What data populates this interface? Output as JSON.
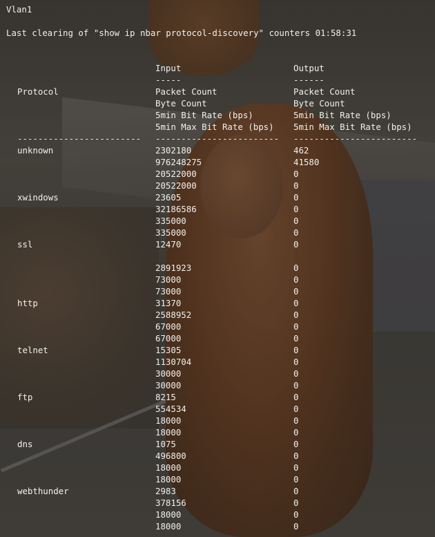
{
  "header": {
    "interface": "Vlan1",
    "last_clearing": "Last clearing of \"show ip nbar protocol-discovery\" counters 01:58:31"
  },
  "columns": {
    "input_title": "Input",
    "output_title": "Output",
    "underline": "-----",
    "output_underline": "------",
    "protocol": "Protocol",
    "metrics": [
      "Packet Count",
      "Byte Count",
      "5min Bit Rate (bps)",
      "5min Max Bit Rate (bps)"
    ],
    "dashes_protocol": "------------------------",
    "dashes_input": "------------------------",
    "dashes_output": "------------------------"
  },
  "rows": [
    {
      "protocol": "unknown",
      "input": [
        "2302180",
        "976248275",
        "20522000",
        "20522000"
      ],
      "output": [
        "462",
        "41580",
        "0",
        "0"
      ]
    },
    {
      "protocol": "xwindows",
      "input": [
        "23605",
        "32186586",
        "335000",
        "335000"
      ],
      "output": [
        "0",
        "0",
        "0",
        "0"
      ]
    },
    {
      "protocol": "ssl",
      "input": [
        "12470",
        "",
        "2891923",
        "73000",
        "73000"
      ],
      "output": [
        "0",
        "",
        "0",
        "0",
        "0"
      ]
    },
    {
      "protocol": "http",
      "input": [
        "31370",
        "2588952",
        "67000",
        "67000"
      ],
      "output": [
        "0",
        "0",
        "0",
        "0"
      ]
    },
    {
      "protocol": "telnet",
      "input": [
        "15305",
        "1130704",
        "30000",
        "30000"
      ],
      "output": [
        "0",
        "0",
        "0",
        "0"
      ]
    },
    {
      "protocol": "ftp",
      "input": [
        "8215",
        "554534",
        "18000",
        "18000"
      ],
      "output": [
        "0",
        "0",
        "0",
        "0"
      ]
    },
    {
      "protocol": "dns",
      "input": [
        "1075",
        "496800",
        "18000",
        "18000"
      ],
      "output": [
        "0",
        "0",
        "0",
        "0"
      ]
    },
    {
      "protocol": "webthunder",
      "input": [
        "2983",
        "378156",
        "18000",
        "18000"
      ],
      "output": [
        "0",
        "0",
        "0",
        "0"
      ]
    }
  ]
}
